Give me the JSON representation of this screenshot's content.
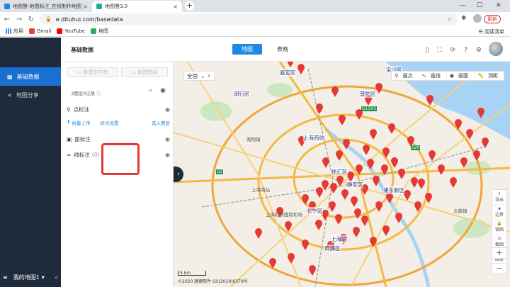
{
  "browser": {
    "tabs": [
      {
        "title": "地图慧-地图标注_在线制作地图",
        "close": "×"
      },
      {
        "title": "地图慧3.0",
        "close": "×"
      }
    ],
    "new_tab": "+",
    "url": "e.dituhui.com/basedata",
    "update_button": "更新",
    "bookmarks": [
      "应用",
      "Gmail",
      "YouTube",
      "地图"
    ],
    "reading_list": "阅读清单",
    "colors": {
      "accent": "#1a73e8",
      "update": "#d93025"
    }
  },
  "sidebar": {
    "items": [
      {
        "icon": "grid-icon",
        "label": "基础数据",
        "active": true
      },
      {
        "icon": "share-icon",
        "label": "地图分享",
        "active": false
      }
    ],
    "footer": {
      "label": "我的地图1",
      "menu_icon": "≡",
      "dropdown": "▾",
      "collapse": "«"
    },
    "colors": {
      "bg": "#1e2b3c",
      "active": "#1a6fd1"
    }
  },
  "header": {
    "title": "基础数据",
    "view_tabs": [
      {
        "label": "地图",
        "active": true
      },
      {
        "label": "表格",
        "active": false
      }
    ]
  },
  "panel": {
    "new_folder": "新建文件夹",
    "new_layer": "新建图层",
    "count_label": "3图层0记录",
    "layers": [
      {
        "name": "点标注",
        "icon": "pin-icon",
        "actions": [
          "批量上传",
          "样式设置",
          "选入图层"
        ]
      },
      {
        "name": "面标注",
        "icon": "polygon-icon",
        "count": ""
      },
      {
        "name": "线标注",
        "icon": "line-icon",
        "count": "(0)"
      }
    ]
  },
  "map": {
    "region": "全国",
    "tools": [
      "画点",
      "画线",
      "画面",
      "测距"
    ],
    "side_tools": [
      "导出",
      "边界",
      "锁图",
      "截图",
      "图层"
    ],
    "zoom_in": "+",
    "zoom_out": "−",
    "scale": "5 km",
    "copyright": "©2020 高德软件 GS(2019)6379号",
    "labels": [
      {
        "text": "上海西站",
        "kind": "place"
      },
      {
        "text": "上海站",
        "kind": "place"
      },
      {
        "text": "静安区",
        "kind": "district"
      },
      {
        "text": "黄浦区",
        "kind": "district"
      },
      {
        "text": "浦东新区",
        "kind": "district"
      },
      {
        "text": "长宁区",
        "kind": "district"
      },
      {
        "text": "徐汇区",
        "kind": "district"
      },
      {
        "text": "普陀区",
        "kind": "district"
      },
      {
        "text": "闵行区",
        "kind": "district"
      },
      {
        "text": "嘉定区",
        "kind": "district"
      },
      {
        "text": "宝山区",
        "kind": "district"
      },
      {
        "text": "上海虹桥国际机场",
        "kind": "airport"
      },
      {
        "text": "上海南站",
        "kind": "place"
      },
      {
        "text": "南翔镇",
        "kind": "place"
      },
      {
        "text": "北蔡镇",
        "kind": "place"
      },
      {
        "text": "G1503",
        "kind": "highway"
      },
      {
        "text": "S20",
        "kind": "highway"
      },
      {
        "text": "G2",
        "kind": "highway"
      }
    ],
    "colors": {
      "water": "#a9d3f5",
      "marker": "#e53935",
      "road": "#f5b942"
    }
  }
}
